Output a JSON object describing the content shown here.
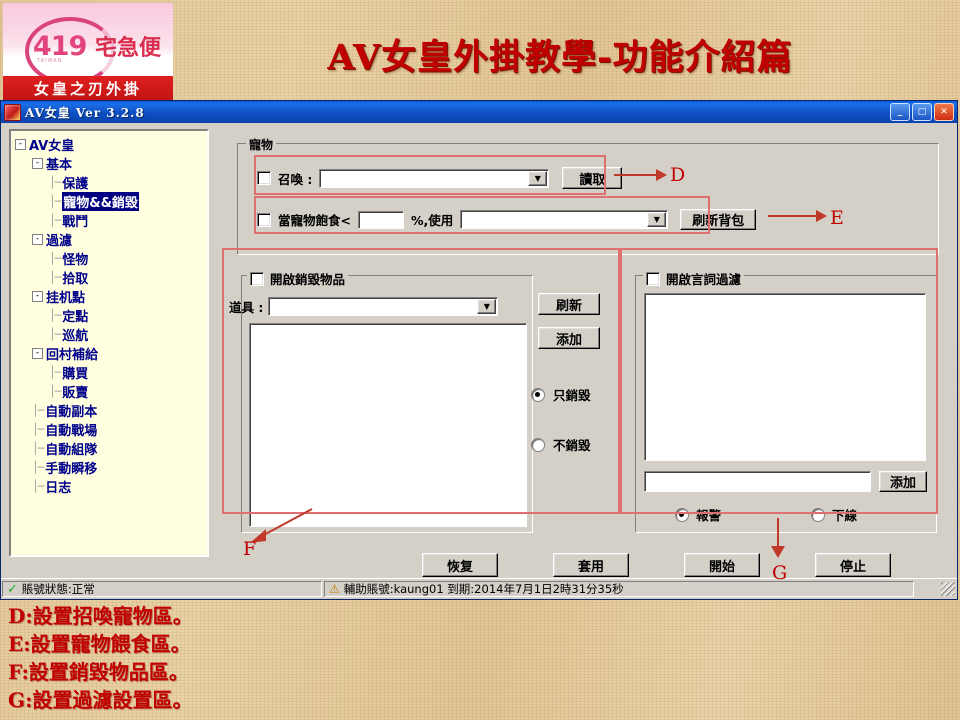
{
  "banner": {
    "title": "AV女皇外掛教學-功能介紹篇",
    "logo_number": "419",
    "logo_word": "宅急便",
    "logo_tiny": "TAIWAN",
    "logo_subtitle": "女皇之刃外掛"
  },
  "window": {
    "title": "AV女皇   Ver 3.2.8",
    "minimize": "_",
    "maximize": "□",
    "close": "✕"
  },
  "tree": {
    "root": "AV女皇",
    "items": [
      {
        "label": "AV女皇",
        "level": 0,
        "box": "-",
        "selected": false
      },
      {
        "label": "基本",
        "level": 1,
        "box": "-",
        "selected": false
      },
      {
        "label": "保護",
        "level": 2,
        "box": "",
        "selected": false
      },
      {
        "label": "寵物&&銷毀",
        "level": 2,
        "box": "",
        "selected": true
      },
      {
        "label": "戰鬥",
        "level": 2,
        "box": "",
        "selected": false
      },
      {
        "label": "過濾",
        "level": 1,
        "box": "-",
        "selected": false
      },
      {
        "label": "怪物",
        "level": 2,
        "box": "",
        "selected": false
      },
      {
        "label": "拾取",
        "level": 2,
        "box": "",
        "selected": false
      },
      {
        "label": "挂机點",
        "level": 1,
        "box": "-",
        "selected": false
      },
      {
        "label": "定點",
        "level": 2,
        "box": "",
        "selected": false
      },
      {
        "label": "巡航",
        "level": 2,
        "box": "",
        "selected": false
      },
      {
        "label": "回村補給",
        "level": 1,
        "box": "-",
        "selected": false
      },
      {
        "label": "購買",
        "level": 2,
        "box": "",
        "selected": false
      },
      {
        "label": "販賣",
        "level": 2,
        "box": "",
        "selected": false
      },
      {
        "label": "自動副本",
        "level": 1,
        "box": "",
        "selected": false
      },
      {
        "label": "自動戰場",
        "level": 1,
        "box": "",
        "selected": false
      },
      {
        "label": "自動組隊",
        "level": 1,
        "box": "",
        "selected": false
      },
      {
        "label": "手動瞬移",
        "level": 1,
        "box": "",
        "selected": false
      },
      {
        "label": "日志",
        "level": 1,
        "box": "",
        "selected": false
      }
    ]
  },
  "pet_group": {
    "title": "寵物",
    "summon_label": "召喚 :",
    "summon_value": "",
    "summon_checked": false,
    "read_button": "讀取",
    "hunger_label": "當寵物飽食<",
    "hunger_value": "",
    "hunger_checked": false,
    "percent_label": "%,使用",
    "food_value": "",
    "refresh_bag_button": "刷新背包"
  },
  "destroy_group": {
    "title": "開啟銷毀物品",
    "checked": false,
    "item_label": "道具 :",
    "item_value": "",
    "refresh_button": "刷新",
    "add_button": "添加",
    "list_items": [],
    "radio_destroy_only": "只銷毀",
    "radio_no_destroy": "不銷毀",
    "radio_selected": "只銷毀"
  },
  "filter_group": {
    "title": "開啟言詞過濾",
    "checked": false,
    "list_items": [],
    "input_value": "",
    "add_button": "添加",
    "radio_alarm": "報警",
    "radio_offline": "下線",
    "radio_selected": "報警"
  },
  "bottom_buttons": {
    "restore": "恢复",
    "apply": "套用",
    "start": "開始",
    "stop": "停止"
  },
  "statusbar": {
    "account_status": "賬號狀態:正常",
    "assist_account": "輔助賬號:kaung01  到期:2014年7月1日2時31分35秒"
  },
  "annotations": {
    "d": "D",
    "e": "E",
    "f": "F",
    "g": "G"
  },
  "legend": [
    "D:設置招喚寵物區。",
    "E:設置寵物餵食區。",
    "F:設置銷毀物品區。",
    "G:設置過濾設置區。"
  ]
}
